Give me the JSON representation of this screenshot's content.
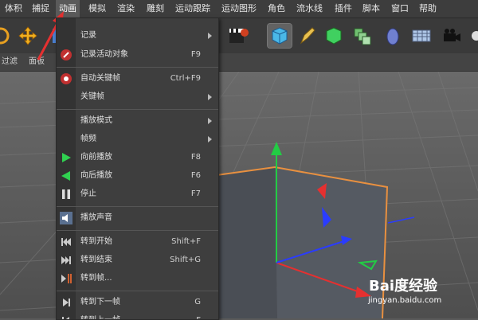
{
  "menubar": {
    "items": [
      "体积",
      "捕捉",
      "动画",
      "模拟",
      "渲染",
      "雕刻",
      "运动跟踪",
      "运动图形",
      "角色",
      "流水线",
      "插件",
      "脚本",
      "窗口",
      "帮助"
    ],
    "active": "动画"
  },
  "viewbar": {
    "items": [
      "过滤",
      "面板"
    ]
  },
  "menu": {
    "items": [
      {
        "label": "记录",
        "submenu": true,
        "icon": "none"
      },
      {
        "label": "记录活动对象",
        "shortcut": "F9",
        "icon": "record-icon"
      },
      {
        "label": "自动关键帧",
        "shortcut": "Ctrl+F9",
        "icon": "autokey-icon"
      },
      {
        "label": "关键帧",
        "submenu": true,
        "icon": "none"
      },
      {
        "label": "播放模式",
        "submenu": true,
        "icon": "none"
      },
      {
        "label": "帧频",
        "submenu": true,
        "icon": "none"
      },
      {
        "label": "向前播放",
        "shortcut": "F8",
        "icon": "play-forward-icon"
      },
      {
        "label": "向后播放",
        "shortcut": "F6",
        "icon": "play-backward-icon"
      },
      {
        "label": "停止",
        "shortcut": "F7",
        "icon": "stop-icon"
      },
      {
        "label": "播放声音",
        "icon": "speaker-icon"
      },
      {
        "label": "转到开始",
        "shortcut": "Shift+F",
        "icon": "goto-start-icon"
      },
      {
        "label": "转到结束",
        "shortcut": "Shift+G",
        "icon": "goto-end-icon"
      },
      {
        "label": "转到帧...",
        "icon": "goto-frame-icon"
      },
      {
        "label": "转到下一帧",
        "shortcut": "G",
        "icon": "next-frame-icon"
      },
      {
        "label": "转到上一帧",
        "shortcut": "F",
        "icon": "prev-frame-icon"
      }
    ]
  },
  "watermark": {
    "brand": "Bai度经验",
    "url": "jingyan.baidu.com"
  },
  "colors": {
    "accent": "#e53030",
    "green": "#22cc44",
    "menu_bg": "#3e3e3e",
    "axis_blue": "#2a3cff"
  }
}
